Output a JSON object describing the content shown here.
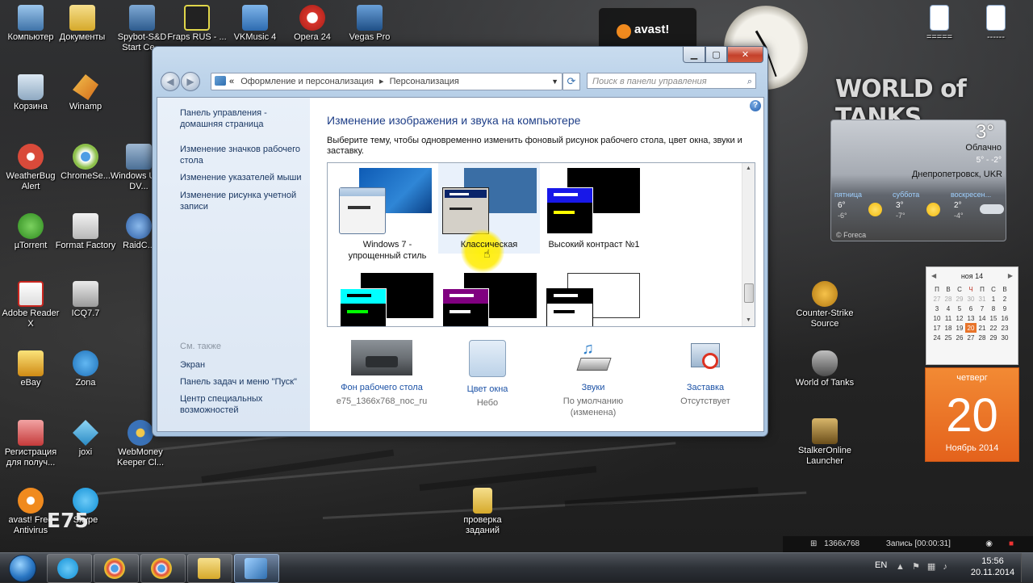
{
  "desktop": {
    "icons_left": [
      {
        "label": "Компьютер",
        "color": "#5b8fc9"
      },
      {
        "label": "Документы",
        "color": "#e7c75a"
      },
      {
        "label": "Spybot-S&D Start Ce...",
        "color": "#4d7fb5"
      },
      {
        "label": "Fraps RUS - ...",
        "color": "#e0d64a"
      },
      {
        "label": "VKMusic 4",
        "color": "#4f8fd6"
      },
      {
        "label": "Opera 24",
        "color": "#d6342b"
      },
      {
        "label": "Vegas Pro",
        "color": "#3b6fa8"
      },
      {
        "label": "Корзина",
        "color": "#a8c2d8"
      },
      {
        "label": "Winamp",
        "color": "#e09a2a"
      },
      {
        "label": "WeatherBug Alert",
        "color": "#d94a3a"
      },
      {
        "label": "ChromeSe...",
        "color": "#5aa0d8"
      },
      {
        "label": "Windows USB DV...",
        "color": "#6b8fb5"
      },
      {
        "label": "µTorrent",
        "color": "#4caa3a"
      },
      {
        "label": "Format Factory",
        "color": "#d8d8d8"
      },
      {
        "label": "RaidC...",
        "color": "#4f7fc0"
      },
      {
        "label": "Adobe Reader X",
        "color": "#c9261f"
      },
      {
        "label": "ICQ7.7",
        "color": "#7fc24a"
      },
      {
        "label": "eBay",
        "color": "#e6b62a"
      },
      {
        "label": "Zona",
        "color": "#2f8fd8"
      },
      {
        "label": "Регистрация для получ...",
        "color": "#d84a4a"
      },
      {
        "label": "joxi",
        "color": "#3aa9e0"
      },
      {
        "label": "WebMoney Keeper Cl...",
        "color": "#3a72b8"
      },
      {
        "label": "avast! Free Antivirus",
        "color": "#f08a1e"
      },
      {
        "label": "Skype",
        "color": "#1aa0e8"
      }
    ],
    "icons_right": [
      {
        "label": "Counter-Strike Source",
        "color": "#e0a22a"
      },
      {
        "label": "World of Tanks",
        "color": "#8a8a8a"
      },
      {
        "label": "StalkerOnline Launcher",
        "color": "#b08a3a"
      }
    ],
    "icons_top_right": [
      {
        "label": "=====",
        "color": "#ffffff"
      },
      {
        "label": "------",
        "color": "#ffffff"
      }
    ],
    "folder_icon": {
      "label": "проверка заданий",
      "color": "#e7c75a"
    },
    "watermark": "E75"
  },
  "gadgets": {
    "avast_label": "avast!",
    "wot_logo": "WORLD of TANKS",
    "weather": {
      "temp": "3°",
      "condition": "Облачно",
      "range": "5° - -2°",
      "city": "Днепропетровск, UKR",
      "forecast": [
        {
          "day": "пятница",
          "hi": "6°",
          "lo": "-6°",
          "icon": "sun"
        },
        {
          "day": "суббота",
          "hi": "3°",
          "lo": "-7°",
          "icon": "sun"
        },
        {
          "day": "воскресен...",
          "hi": "2°",
          "lo": "-4°",
          "icon": "cloud"
        }
      ],
      "credit": "© Foreca"
    },
    "calendar": {
      "month": "ноя 14",
      "weekdays": [
        "П",
        "В",
        "С",
        "Ч",
        "П",
        "С",
        "В"
      ],
      "rows": [
        [
          "27",
          "28",
          "29",
          "30",
          "31",
          "1",
          "2"
        ],
        [
          "3",
          "4",
          "5",
          "6",
          "7",
          "8",
          "9"
        ],
        [
          "10",
          "11",
          "12",
          "13",
          "14",
          "15",
          "16"
        ],
        [
          "17",
          "18",
          "19",
          "20",
          "21",
          "22",
          "23"
        ],
        [
          "24",
          "25",
          "26",
          "27",
          "28",
          "29",
          "30"
        ]
      ],
      "today": "20"
    },
    "date": {
      "weekday": "четверг",
      "day": "20",
      "month_year": "Ноябрь 2014"
    },
    "record": {
      "resolution": "1366x768",
      "recording": "Запись [00:00:31]"
    }
  },
  "window": {
    "breadcrumb": [
      "Оформление и персонализация",
      "Персонализация"
    ],
    "search_placeholder": "Поиск в панели управления",
    "help": "?",
    "left_pane": {
      "links": [
        "Панель управления - домашняя страница",
        "Изменение значков рабочего стола",
        "Изменение указателей мыши",
        "Изменение рисунка учетной записи"
      ],
      "see_also_heading": "См. также",
      "see_also": [
        "Экран",
        "Панель задач и меню \"Пуск\"",
        "Центр специальных возможностей"
      ]
    },
    "main": {
      "title": "Изменение изображения и звука на компьютере",
      "description": "Выберите тему, чтобы одновременно изменить фоновый рисунок рабочего стола, цвет окна, звуки и заставку.",
      "themes": [
        {
          "label": "Windows 7 - упрощенный стиль",
          "selected": false
        },
        {
          "label": "Классическая",
          "selected": true
        },
        {
          "label": "Высокий контраст №1",
          "selected": false
        },
        {
          "label": "",
          "selected": false
        },
        {
          "label": "",
          "selected": false
        },
        {
          "label": "",
          "selected": false
        }
      ],
      "bottom": [
        {
          "link": "Фон рабочего стола",
          "value": "e75_1366x768_noc_ru"
        },
        {
          "link": "Цвет окна",
          "value": "Небо"
        },
        {
          "link": "Звуки",
          "value": "По умолчанию (изменена)"
        },
        {
          "link": "Заставка",
          "value": "Отсутствует"
        }
      ]
    }
  },
  "taskbar": {
    "apps": [
      "skype",
      "chrome",
      "chrome",
      "explorer",
      "control-panel"
    ],
    "lang": "EN",
    "time": "15:56",
    "date": "20.11.2014"
  }
}
